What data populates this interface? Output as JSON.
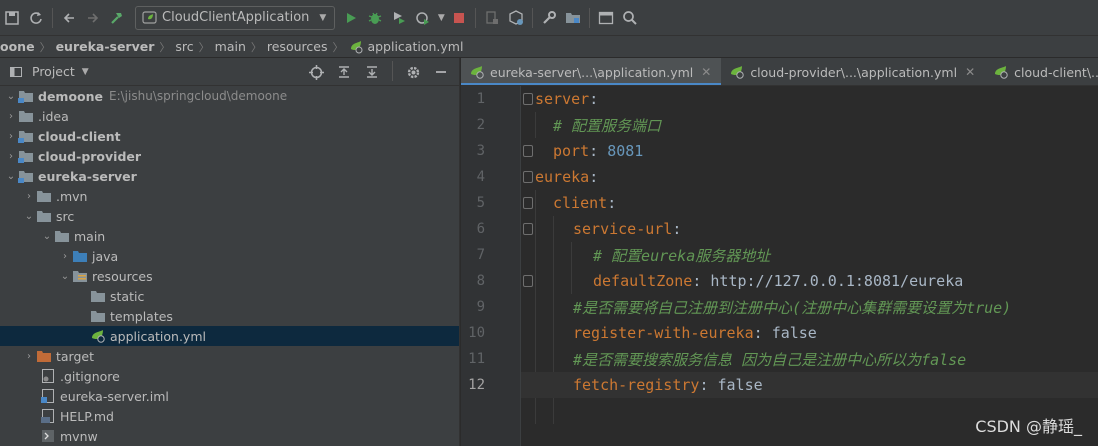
{
  "toolbar": {
    "run_config": "CloudClientApplication"
  },
  "breadcrumb": {
    "items": [
      "oone",
      "eureka-server",
      "src",
      "main",
      "resources",
      "application.yml"
    ]
  },
  "project_panel": {
    "title": "Project"
  },
  "tree": [
    {
      "label": "demoone",
      "path": "E:\\jishu\\springcloud\\demoone"
    },
    {
      "label": ".idea"
    },
    {
      "label": "cloud-client"
    },
    {
      "label": "cloud-provider"
    },
    {
      "label": "eureka-server"
    },
    {
      "label": ".mvn"
    },
    {
      "label": "src"
    },
    {
      "label": "main"
    },
    {
      "label": "java"
    },
    {
      "label": "resources"
    },
    {
      "label": "static"
    },
    {
      "label": "templates"
    },
    {
      "label": "application.yml"
    },
    {
      "label": "target"
    },
    {
      "label": ".gitignore"
    },
    {
      "label": "eureka-server.iml"
    },
    {
      "label": "HELP.md"
    },
    {
      "label": "mvnw"
    }
  ],
  "tabs": [
    {
      "label": "eureka-server\\...\\application.yml"
    },
    {
      "label": "cloud-provider\\...\\application.yml"
    },
    {
      "label": "cloud-client\\...\\applica"
    }
  ],
  "code": {
    "line_numbers": [
      "1",
      "2",
      "3",
      "4",
      "5",
      "6",
      "7",
      "8",
      "9",
      "10",
      "11",
      "12"
    ],
    "l1_key": "server",
    "l2_comment": "# 配置服务端口",
    "l3_key": "port",
    "l3_value": "8081",
    "l4_key": "eureka",
    "l5_key": "client",
    "l6_key": "service-url",
    "l7_comment": "# 配置eureka服务器地址",
    "l8_key": "defaultZone",
    "l8_value": "http://127.0.0.1:8081/eureka",
    "l9_comment": "#是否需要将自己注册到注册中心(注册中心集群需要设置为true)",
    "l10_key": "register-with-eureka",
    "l10_value": "false",
    "l11_comment": "#是否需要搜索服务信息 因为自己是注册中心所以为false",
    "l12_key": "fetch-registry",
    "l12_value": "false"
  },
  "watermark": "CSDN @静瑶_",
  "colors": {
    "keyword": "#cc7832",
    "comment": "#629755",
    "number": "#6897bb",
    "text": "#a9b7c6",
    "selection": "#0d293e",
    "tab_accent": "#4a88c7"
  }
}
